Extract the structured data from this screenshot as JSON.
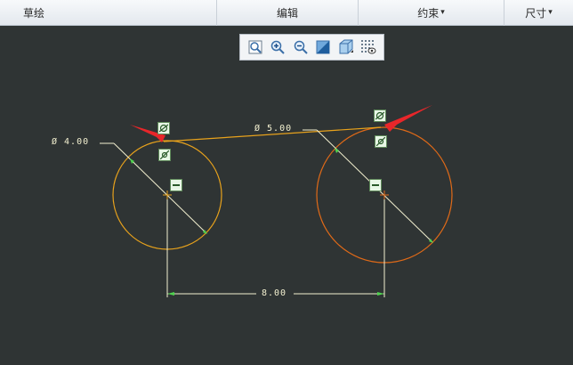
{
  "menubar": {
    "items": [
      {
        "label": "草绘",
        "icon": ""
      },
      {
        "label": "编辑",
        "icon": ""
      },
      {
        "label": "约束",
        "icon": "▾"
      },
      {
        "label": "尺寸",
        "icon": "▾"
      }
    ]
  },
  "toolbar": {
    "buttons": [
      {
        "name": "zoom-window-icon"
      },
      {
        "name": "zoom-in-icon"
      },
      {
        "name": "zoom-out-icon"
      },
      {
        "name": "repaint-icon"
      },
      {
        "name": "display-style-icon"
      },
      {
        "name": "sketch-display-filter-icon"
      }
    ]
  },
  "sketch": {
    "left_diameter": "Ø  4.00",
    "right_diameter": "Ø  5.00",
    "center_distance": "8.00",
    "colors": {
      "background": "#2f3434",
      "left_circle": "#e8a21c",
      "right_circle": "#e06a18",
      "tangent_line": "#e8a21c",
      "dimension": "#f3f0d0",
      "constraint_marker": "#4fd24f",
      "arrow": "#e8262a"
    }
  }
}
